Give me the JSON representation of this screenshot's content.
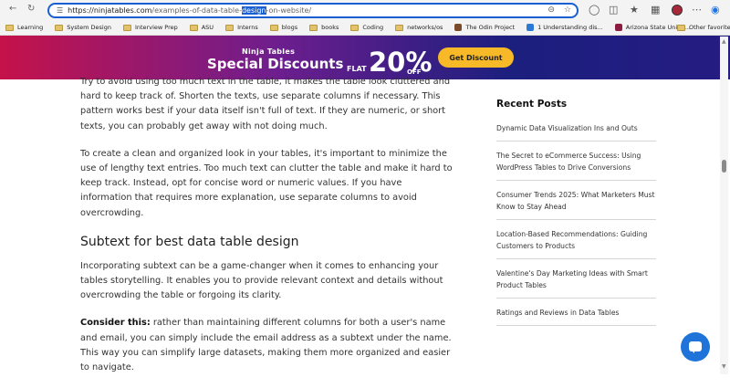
{
  "browser": {
    "url_host": "https://ninjatables.com",
    "url_path_before": "/examples-of-data-table-",
    "url_selected": "design",
    "url_path_after": "-on-website/"
  },
  "bookmarks": [
    {
      "label": "Learning",
      "kind": "folder"
    },
    {
      "label": "System Design",
      "kind": "folder"
    },
    {
      "label": "Interview Prep",
      "kind": "folder"
    },
    {
      "label": "ASU",
      "kind": "folder"
    },
    {
      "label": "Interns",
      "kind": "folder"
    },
    {
      "label": "blogs",
      "kind": "folder"
    },
    {
      "label": "books",
      "kind": "folder"
    },
    {
      "label": "Coding",
      "kind": "folder"
    },
    {
      "label": "networks/os",
      "kind": "folder"
    },
    {
      "label": "The Odin Project",
      "kind": "site",
      "color": "#7a4b2a"
    },
    {
      "label": "1 Understanding dis...",
      "kind": "site",
      "color": "#2b7bd6"
    },
    {
      "label": "Arizona State Unive...",
      "kind": "site",
      "color": "#8c1d40"
    }
  ],
  "bookmarks_other": "Other favorites",
  "banner": {
    "brand": "Ninja Tables",
    "headline": "Special Discounts",
    "flat": "FLAT",
    "percent": "20%",
    "off": "OFF",
    "cta": "Get Discount"
  },
  "article": {
    "p1": "Try to avoid using too much text in the table, it makes the table look cluttered and hard to keep track of. Shorten the texts, use separate columns if necessary. This pattern works best if your data itself isn't full of text. If they are numeric, or short texts, you can probably get away with not doing much.",
    "p2": "To create a clean and organized look in your tables, it's important to minimize the use of lengthy text entries. Too much text can clutter the table and make it hard to keep track. Instead, opt for concise word or numeric values. If you have information that requires more explanation, use separate columns to avoid overcrowding.",
    "h2": "Subtext for best data table design",
    "p3": "Incorporating subtext can be a game-changer when it comes to enhancing your tables storytelling. It enables you to provide relevant context and details without overcrowding the table or forgoing its clarity.",
    "p4_bold": "Consider this:",
    "p4_rest": " rather than maintaining different columns for both a user's name and email, you can simply include the email address as a subtext under the name. This way you can simplify large datasets, making them more organized and easier to navigate."
  },
  "sidebar": {
    "title": "Recent Posts",
    "posts": [
      "Dynamic Data Visualization Ins and Outs",
      "The Secret to eCommerce Success: Using WordPress Tables to Drive Conversions",
      "Consumer Trends 2025: What Marketers Must Know to Stay Ahead",
      "Location-Based Recommendations: Guiding Customers to Products",
      "Valentine's Day Marketing Ideas with Smart Product Tables",
      "Ratings and Reviews in Data Tables"
    ]
  }
}
